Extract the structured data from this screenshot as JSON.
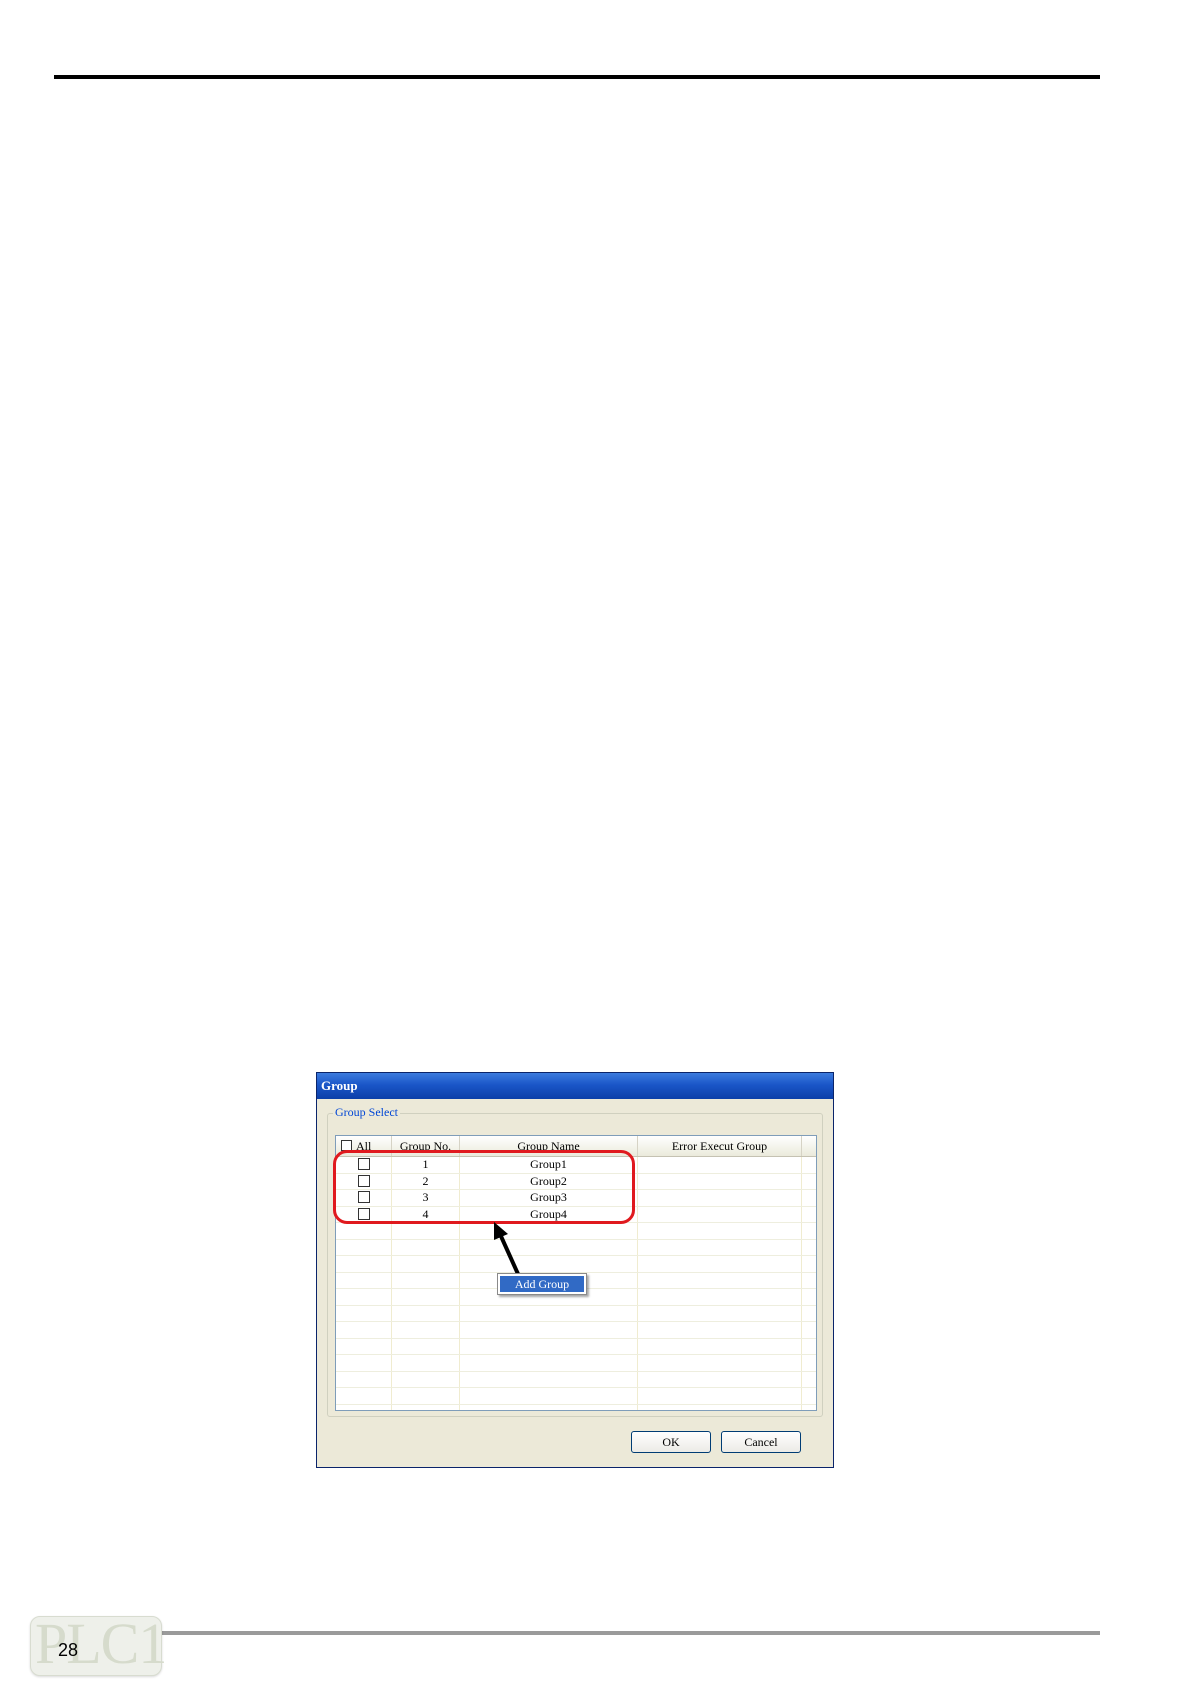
{
  "page": {
    "number": "28"
  },
  "logo": {
    "text": "PLC1"
  },
  "dialog": {
    "title": "Group",
    "groupbox_label": "Group Select",
    "columns": {
      "select_all": "All",
      "group_no": "Group No.",
      "group_name": "Group Name",
      "error_execute": "Error Execut Group"
    },
    "rows": [
      {
        "no": "1",
        "name": "Group1",
        "checked": false
      },
      {
        "no": "2",
        "name": "Group2",
        "checked": false
      },
      {
        "no": "3",
        "name": "Group3",
        "checked": false
      },
      {
        "no": "4",
        "name": "Group4",
        "checked": false
      }
    ],
    "context_menu": {
      "item": "Add Group"
    },
    "ok_label": "OK",
    "cancel_label": "Cancel"
  },
  "annotation": {
    "highlight_color": "#e0191e",
    "arrow_icon": "arrow-up-left-icon"
  }
}
